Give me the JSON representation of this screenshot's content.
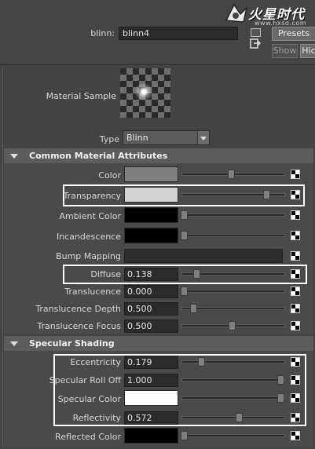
{
  "header": {
    "logo_text": "火星时代",
    "logo_url": "www.hxsd.com",
    "name_label": "blinn:",
    "name_value": "blinn4",
    "presets_label": "Presets",
    "show_label": "Show",
    "hide_label": "Hic"
  },
  "material_sample": {
    "label": "Material Sample"
  },
  "type_select": {
    "label": "Type",
    "value": "Blinn"
  },
  "sections": {
    "common": {
      "title": "Common Material Attributes"
    },
    "specular": {
      "title": "Specular Shading"
    }
  },
  "common_attrs": {
    "color": {
      "label": "Color",
      "swatch": "#7f7f7f",
      "slider": 0.5
    },
    "transparency": {
      "label": "Transparency",
      "swatch": "#d4d4d4",
      "slider": 0.83
    },
    "ambient_color": {
      "label": "Ambient Color",
      "swatch": "#000000",
      "slider": 0.0
    },
    "incandescence": {
      "label": "Incandescence",
      "swatch": "#000000",
      "slider": 0.0
    },
    "bump_mapping": {
      "label": "Bump Mapping"
    },
    "diffuse": {
      "label": "Diffuse",
      "value": "0.138",
      "slider": 0.138
    },
    "translucence": {
      "label": "Translucence",
      "value": "0.000",
      "slider": 0.0
    },
    "translucence_depth": {
      "label": "Translucence Depth",
      "value": "0.500",
      "slider": 0.1
    },
    "translucence_focus": {
      "label": "Translucence Focus",
      "value": "0.500",
      "slider": 0.5
    }
  },
  "specular_attrs": {
    "eccentricity": {
      "label": "Eccentricity",
      "value": "0.179",
      "slider": 0.179
    },
    "specular_roll_off": {
      "label": "Specular Roll Off",
      "value": "1.000",
      "slider": 1.0
    },
    "specular_color": {
      "label": "Specular Color",
      "swatch": "#ffffff",
      "slider": 1.0
    },
    "reflectivity": {
      "label": "Reflectivity",
      "value": "0.572",
      "slider": 0.572
    },
    "reflected_color": {
      "label": "Reflected Color",
      "swatch": "#000000",
      "slider": 0.0
    }
  }
}
